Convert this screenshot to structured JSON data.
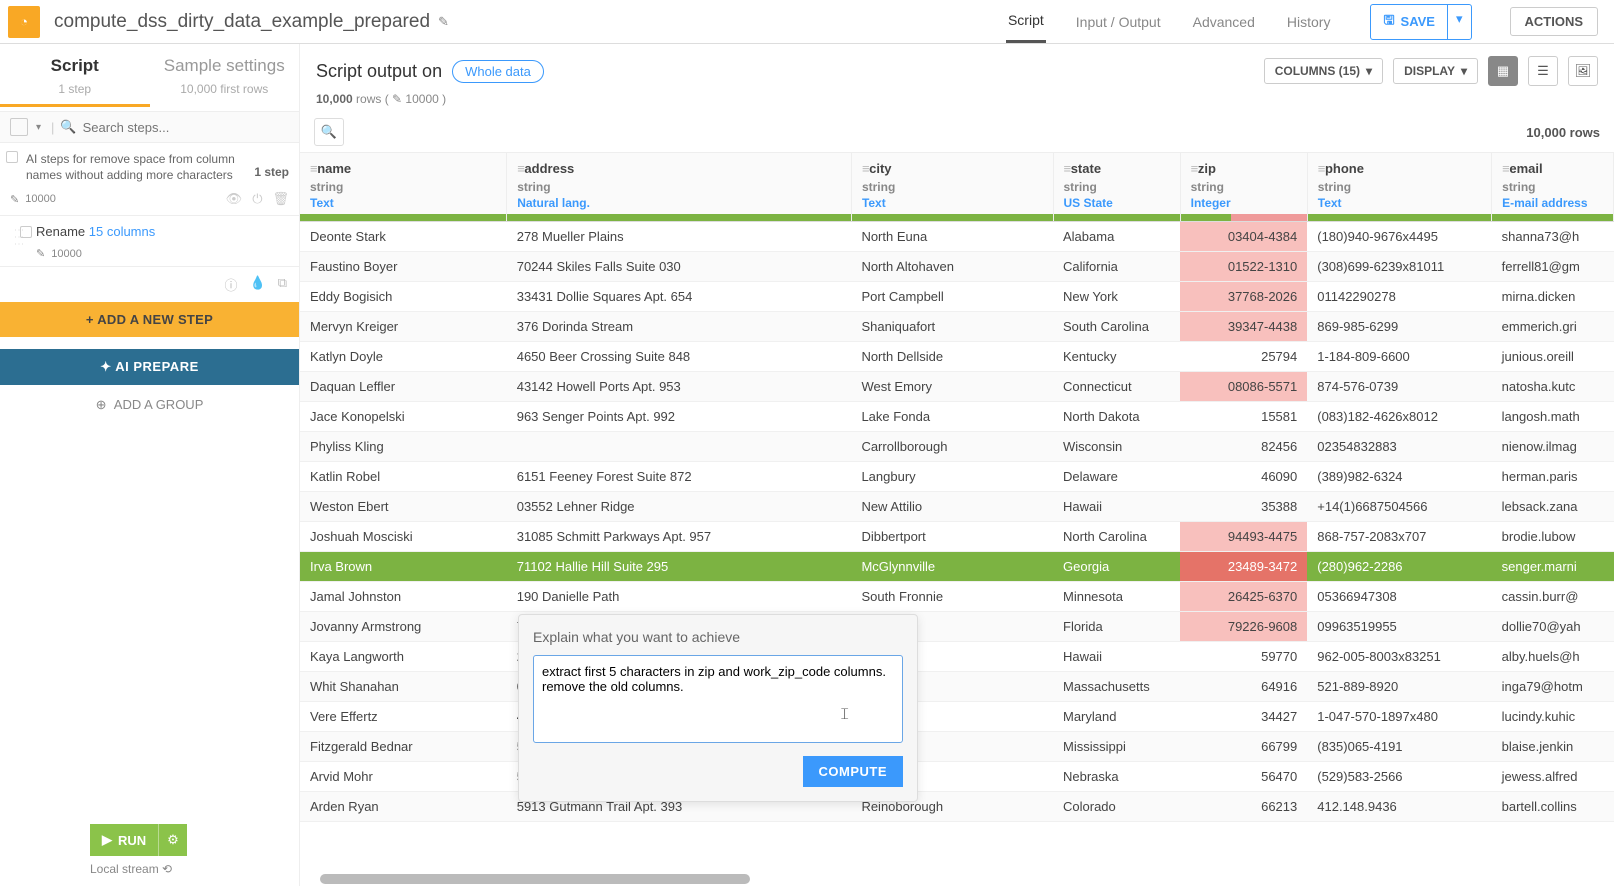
{
  "header": {
    "recipe_name": "compute_dss_dirty_data_example_prepared",
    "tabs": [
      "Script",
      "Input / Output",
      "Advanced",
      "History"
    ],
    "active_tab": "Script",
    "save": "SAVE",
    "actions": "ACTIONS"
  },
  "left": {
    "tabs": {
      "script": {
        "title": "Script",
        "sub": "1 step"
      },
      "sample": {
        "title": "Sample settings",
        "sub": "10,000 first rows"
      }
    },
    "search_placeholder": "Search steps...",
    "group": {
      "title": "AI steps for remove space from column names without adding more characters",
      "count": "1 step",
      "rows": "10000"
    },
    "step": {
      "label": "Rename 15 columns",
      "rows": "10000"
    },
    "add_step": "+ ADD A NEW STEP",
    "ai_prepare": "✦  AI PREPARE",
    "add_group": "ADD A GROUP",
    "run": "RUN",
    "local": "Local stream"
  },
  "right_header": {
    "title": "Script output on",
    "whole": "Whole data",
    "rows_line_bold": "10,000",
    "rows_line_rest": " rows ( ✎ 10000 )",
    "columns": "COLUMNS (15)",
    "display": "DISPLAY",
    "total_rows": "10,000 rows"
  },
  "columns": [
    {
      "name": "name",
      "type": "string",
      "meaning": "Text",
      "qual_g": 100
    },
    {
      "name": "address",
      "type": "string",
      "meaning": "Natural lang.",
      "qual_g": 100
    },
    {
      "name": "city",
      "type": "string",
      "meaning": "Text",
      "qual_g": 100
    },
    {
      "name": "state",
      "type": "string",
      "meaning": "US State",
      "qual_g": 100
    },
    {
      "name": "zip",
      "type": "string",
      "meaning": "Integer",
      "qual_g": 40
    },
    {
      "name": "phone",
      "type": "string",
      "meaning": "Text",
      "qual_g": 100
    },
    {
      "name": "email",
      "type": "string",
      "meaning": "E-mail address",
      "qual_g": 100
    }
  ],
  "rows": [
    {
      "name": "Deonte Stark",
      "address": "278 Mueller Plains",
      "city": "North Euna",
      "state": "Alabama",
      "zip": "03404-4384",
      "zip_bad": true,
      "phone": "(180)940-9676x4495",
      "email": "shanna73@h"
    },
    {
      "name": "Faustino Boyer",
      "address": "70244 Skiles Falls Suite 030",
      "city": "North Altohaven",
      "state": "California",
      "zip": "01522-1310",
      "zip_bad": true,
      "phone": "(308)699-6239x81011",
      "email": "ferrell81@gm"
    },
    {
      "name": "Eddy Bogisich",
      "address": "33431 Dollie Squares Apt. 654",
      "city": "Port Campbell",
      "state": "New York",
      "zip": "37768-2026",
      "zip_bad": true,
      "phone": "01142290278",
      "email": "mirna.dicken"
    },
    {
      "name": "Mervyn Kreiger",
      "address": "376 Dorinda Stream",
      "city": "Shaniquafort",
      "state": "South Carolina",
      "zip": "39347-4438",
      "zip_bad": true,
      "phone": "869-985-6299",
      "email": "emmerich.gri"
    },
    {
      "name": "Katlyn Doyle",
      "address": "4650 Beer Crossing Suite 848",
      "city": "North Dellside",
      "state": "Kentucky",
      "zip": "25794",
      "zip_bad": false,
      "phone": "1-184-809-6600",
      "email": "junious.oreill"
    },
    {
      "name": "Daquan Leffler",
      "address": "43142 Howell Ports Apt. 953",
      "city": "West Emory",
      "state": "Connecticut",
      "zip": "08086-5571",
      "zip_bad": true,
      "phone": "874-576-0739",
      "email": "natosha.kutc"
    },
    {
      "name": "Jace Konopelski",
      "address": "963 Senger Points Apt. 992",
      "city": "Lake Fonda",
      "state": "North Dakota",
      "zip": "15581",
      "zip_bad": false,
      "phone": "(083)182-4626x8012",
      "email": "langosh.math"
    },
    {
      "name": "Phyliss Kling",
      "address": "",
      "city": "Carrollborough",
      "state": "Wisconsin",
      "zip": "82456",
      "zip_bad": false,
      "phone": "02354832883",
      "email": "nienow.ilmag"
    },
    {
      "name": "Katlin Robel",
      "address": "6151 Feeney Forest Suite 872",
      "city": "Langbury",
      "state": "Delaware",
      "zip": "46090",
      "zip_bad": false,
      "phone": "(389)982-6324",
      "email": "herman.paris"
    },
    {
      "name": "Weston Ebert",
      "address": "03552 Lehner Ridge",
      "city": "New Attilio",
      "state": "Hawaii",
      "zip": "35388",
      "zip_bad": false,
      "phone": "+14(1)6687504566",
      "email": "lebsack.zana"
    },
    {
      "name": "Joshuah Mosciski",
      "address": "31085 Schmitt Parkways Apt. 957",
      "city": "Dibbertport",
      "state": "North Carolina",
      "zip": "94493-4475",
      "zip_bad": true,
      "phone": "868-757-2083x707",
      "email": "brodie.lubow"
    },
    {
      "name": "Irva Brown",
      "address": "71102 Hallie Hill Suite 295",
      "city": "McGlynnville",
      "state": "Georgia",
      "zip": "23489-3472",
      "zip_bad": true,
      "phone": "(280)962-2286",
      "email": "senger.marni",
      "sel": true
    },
    {
      "name": "Jamal Johnston",
      "address": "190 Danielle Path",
      "city": "South Fronnie",
      "state": "Minnesota",
      "zip": "26425-6370",
      "zip_bad": true,
      "phone": "05366947308",
      "email": "cassin.burr@"
    },
    {
      "name": "Jovanny Armstrong",
      "address": "7",
      "city": "",
      "state": "Florida",
      "zip": "79226-9608",
      "zip_bad": true,
      "phone": "09963519955",
      "email": "dollie70@yah"
    },
    {
      "name": "Kaya Langworth",
      "address": "2",
      "city": "",
      "state": "Hawaii",
      "zip": "59770",
      "zip_bad": false,
      "phone": "962-005-8003x83251",
      "email": "alby.huels@h"
    },
    {
      "name": "Whit Shanahan",
      "address": "0",
      "city": "",
      "state": "Massachusetts",
      "zip": "64916",
      "zip_bad": false,
      "phone": "521-889-8920",
      "email": "inga79@hotm"
    },
    {
      "name": "Vere Effertz",
      "address": "4",
      "city": "",
      "state": "Maryland",
      "zip": "34427",
      "zip_bad": false,
      "phone": "1-047-570-1897x480",
      "email": "lucindy.kuhic"
    },
    {
      "name": "Fitzgerald Bednar",
      "address": "5",
      "city": "",
      "state": "Mississippi",
      "zip": "66799",
      "zip_bad": false,
      "phone": "(835)065-4191",
      "email": "blaise.jenkin"
    },
    {
      "name": "Arvid Mohr",
      "address": "5",
      "city": "",
      "state": "Nebraska",
      "zip": "56470",
      "zip_bad": false,
      "phone": "(529)583-2566",
      "email": "jewess.alfred"
    },
    {
      "name": "Arden Ryan",
      "address": "5913 Gutmann Trail Apt. 393",
      "city": "Reinoborough",
      "state": "Colorado",
      "zip": "66213",
      "zip_bad": false,
      "phone": "412.148.9436",
      "email": "bartell.collins"
    }
  ],
  "popup": {
    "title": "Explain what you want to achieve",
    "value": "extract first 5 characters in zip and work_zip_code columns. remove the old columns.",
    "compute": "COMPUTE"
  }
}
